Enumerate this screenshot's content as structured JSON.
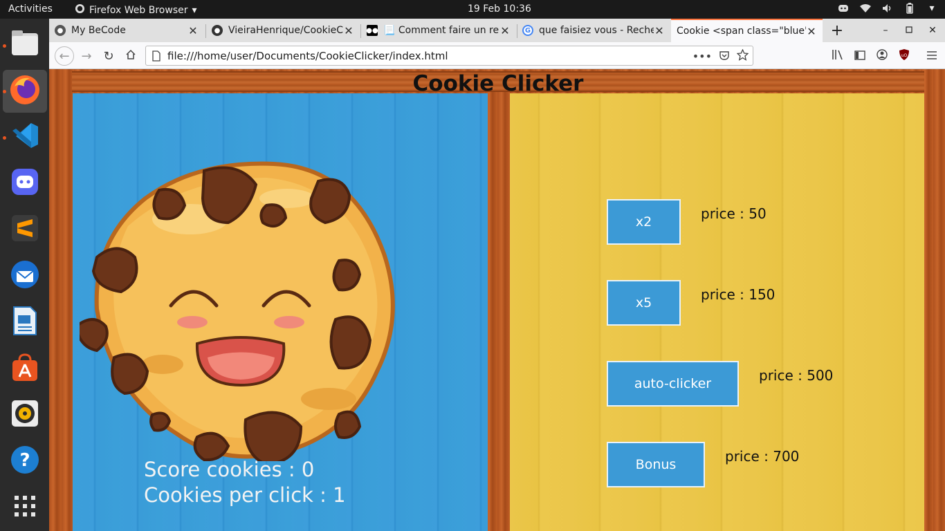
{
  "topbar": {
    "activities": "Activities",
    "app_name": "Firefox Web Browser",
    "clock": "19 Feb  10:36"
  },
  "dock": {
    "items": [
      "files-icon",
      "firefox-icon",
      "vscode-icon",
      "discord-icon",
      "sublime-text-icon",
      "thunderbird-icon",
      "libreoffice-impress-icon",
      "software-center-icon",
      "rhythmbox-icon",
      "help-icon",
      "show-apps-icon"
    ]
  },
  "tabs": [
    {
      "title": "My BeCode"
    },
    {
      "title": "VieiraHenrique/CookieCl"
    },
    {
      "title": "📃 Comment faire un rea"
    },
    {
      "title": "que faisiez vous - Recher"
    },
    {
      "title": "Cookie <span class=\"blue\">C"
    }
  ],
  "navbar": {
    "url": "file:///home/user/Documents/CookieClicker/index.html"
  },
  "game": {
    "title": "Cookie Clicker",
    "score_label": "Score cookies : 0",
    "per_click_label": "Cookies per click : 1",
    "shop": [
      {
        "label": "x2",
        "price": "price : 50"
      },
      {
        "label": "x5",
        "price": "price : 150"
      },
      {
        "label": "auto-clicker",
        "price": "price : 500"
      },
      {
        "label": "Bonus",
        "price": "price : 700"
      }
    ]
  },
  "colors": {
    "panel_blue": "#3b9fd9",
    "panel_yellow": "#ebc64a",
    "button_blue": "#3c9ad6",
    "firefox_accent": "#ff7139"
  }
}
